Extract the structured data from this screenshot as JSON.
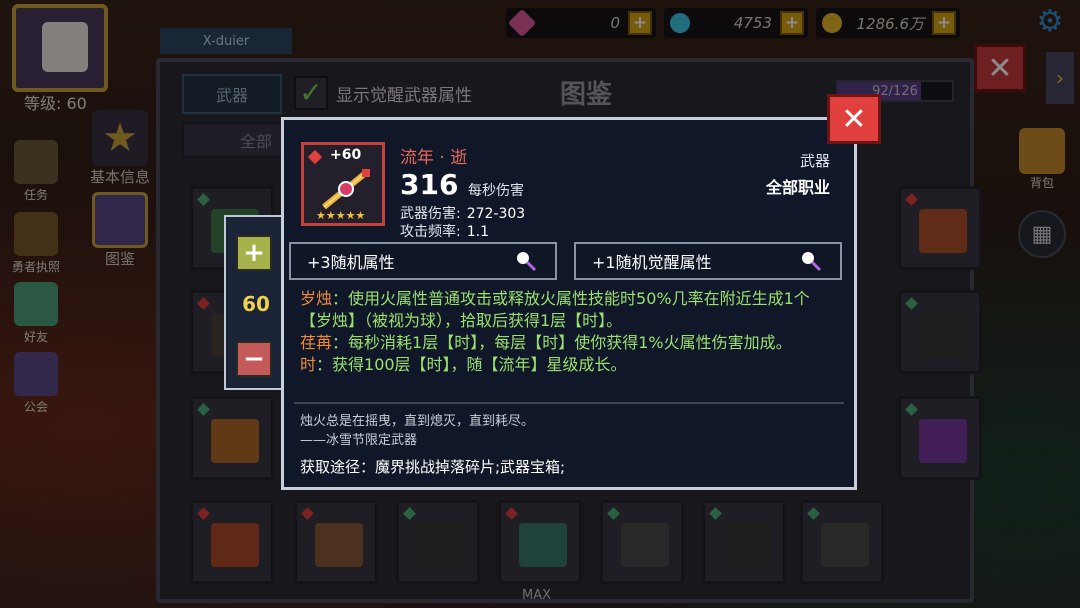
{
  "hud": {
    "level": "等级: 60",
    "player_name": "X-duier",
    "currencies": [
      {
        "icon": "gem-icon",
        "value": "0",
        "color": "#e05a9a"
      },
      {
        "icon": "diamond-icon",
        "value": "4753",
        "color": "#3cc7e6"
      },
      {
        "icon": "gold-coin-icon",
        "value": "1286.6万",
        "color": "#e8b92b"
      }
    ]
  },
  "side_menu": {
    "left": [
      {
        "label": "任务",
        "icon": "task-icon"
      },
      {
        "label": "勇者执照",
        "icon": "license-icon"
      },
      {
        "label": "好友",
        "icon": "friends-icon"
      },
      {
        "label": "公会",
        "icon": "guild-icon"
      }
    ],
    "center": [
      {
        "label": "基本信息",
        "icon": "star-icon"
      },
      {
        "label": "图鉴",
        "icon": "codex-icon"
      }
    ],
    "right": [
      {
        "label": "背包",
        "icon": "backpack-icon"
      }
    ]
  },
  "codex": {
    "title": "图鉴",
    "tab_label": "武器",
    "awaken_toggle_label": "显示觉醒武器属性",
    "awaken_checked": true,
    "progress_text": "92/126",
    "progress_fraction": 0.73,
    "filters": [
      "全部",
      "全部",
      "全部"
    ],
    "bottom_label": "MAX"
  },
  "level_stepper": {
    "value": "60"
  },
  "weapon": {
    "name": "流年 · 逝",
    "plus": "+60",
    "stars": "★★★★★",
    "dps": "316",
    "dps_label": "每秒伤害",
    "damage_label": "武器伤害:",
    "damage_value": "272-303",
    "rate_label": "攻击频率:",
    "rate_value": "1.1",
    "type": "武器",
    "class": "全部职业",
    "random_attr_button": "+3随机属性",
    "awaken_attr_button": "+1随机觉醒属性",
    "effects": [
      {
        "keyword": "岁烛",
        "text": "：使用火属性普通攻击或释放火属性技能时50%几率在附近生成1个【岁烛】（被视为球），拾取后获得1层【时】。"
      },
      {
        "keyword": "荏苒",
        "text": "：每秒消耗1层【时】，每层【时】使你获得1%火属性伤害加成。"
      },
      {
        "keyword": "时",
        "text": "：获得100层【时】，随【流年】星级成长。"
      }
    ],
    "lore": "烛火总是在摇曳，直到熄灭，直到耗尽。",
    "lore_note": "——冰雪节限定武器",
    "source": "获取途径：魔界挑战掉落碎片;武器宝箱;"
  }
}
